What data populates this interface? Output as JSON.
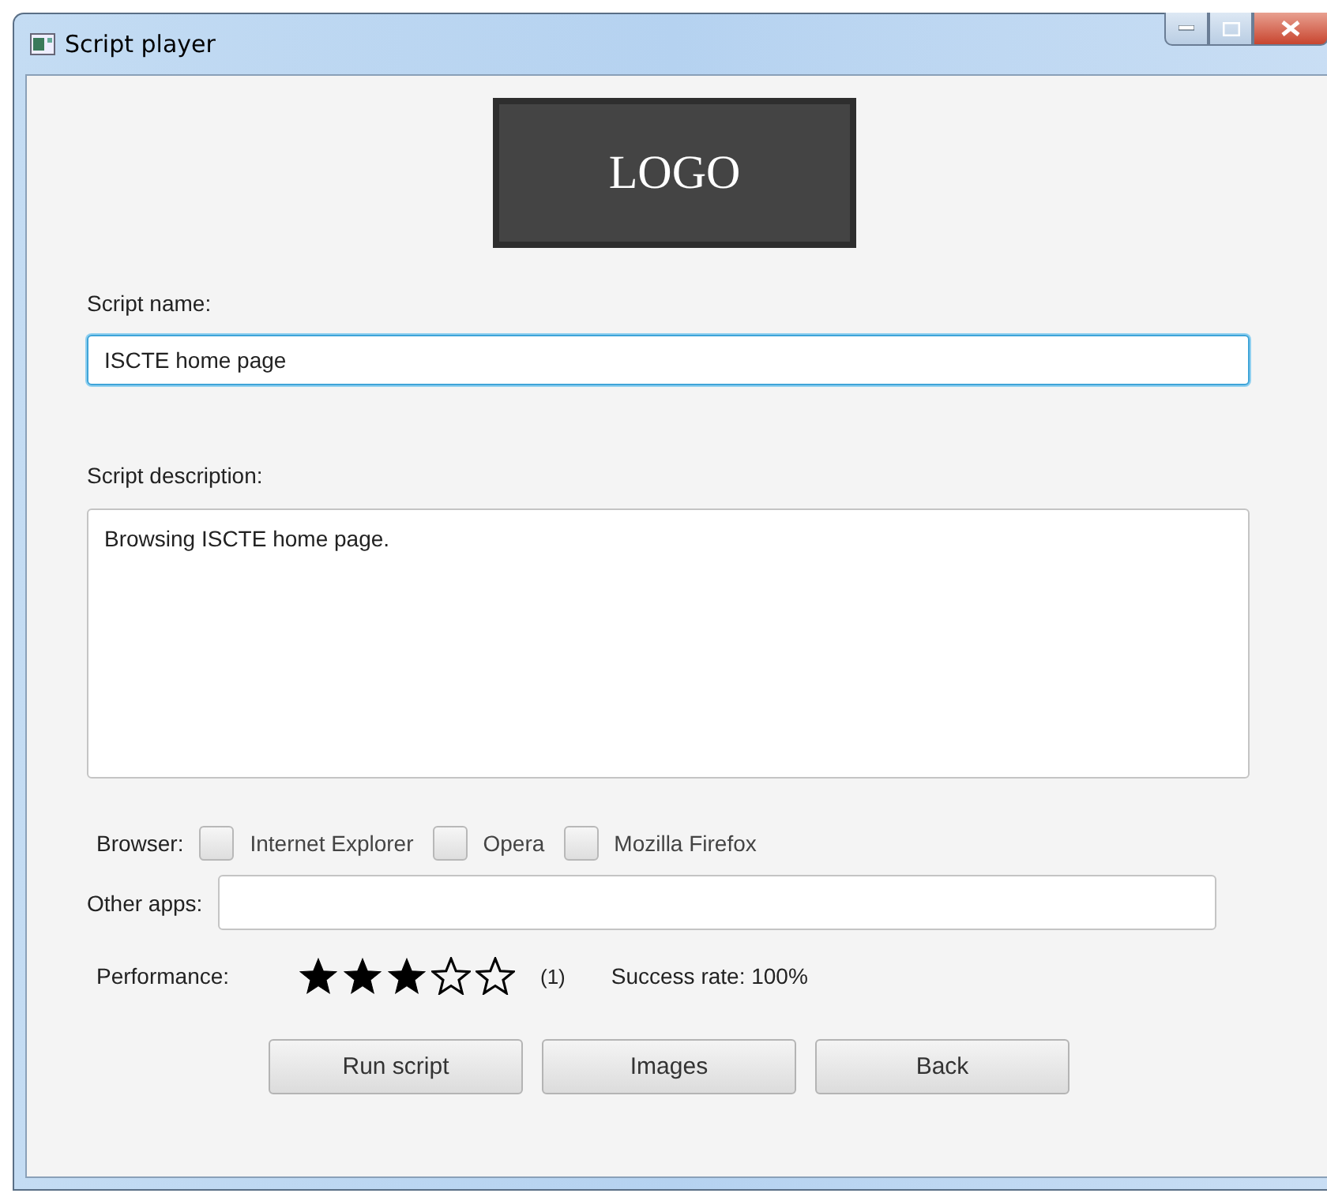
{
  "window": {
    "title": "Script player"
  },
  "logo": "LOGO",
  "script_name": {
    "label": "Script name:",
    "value": "ISCTE home page"
  },
  "script_description": {
    "label": "Script description:",
    "value": "Browsing ISCTE home page."
  },
  "browser": {
    "label": "Browser:",
    "options": [
      {
        "label": "Internet Explorer",
        "checked": false
      },
      {
        "label": "Opera",
        "checked": false
      },
      {
        "label": "Mozilla Firefox",
        "checked": false
      }
    ]
  },
  "other_apps": {
    "label": "Other apps:"
  },
  "performance": {
    "label": "Performance:",
    "stars": 3,
    "count": "(1)",
    "success_rate": "Success rate: 100%"
  },
  "buttons": [
    "Run script",
    "Images",
    "Back"
  ]
}
